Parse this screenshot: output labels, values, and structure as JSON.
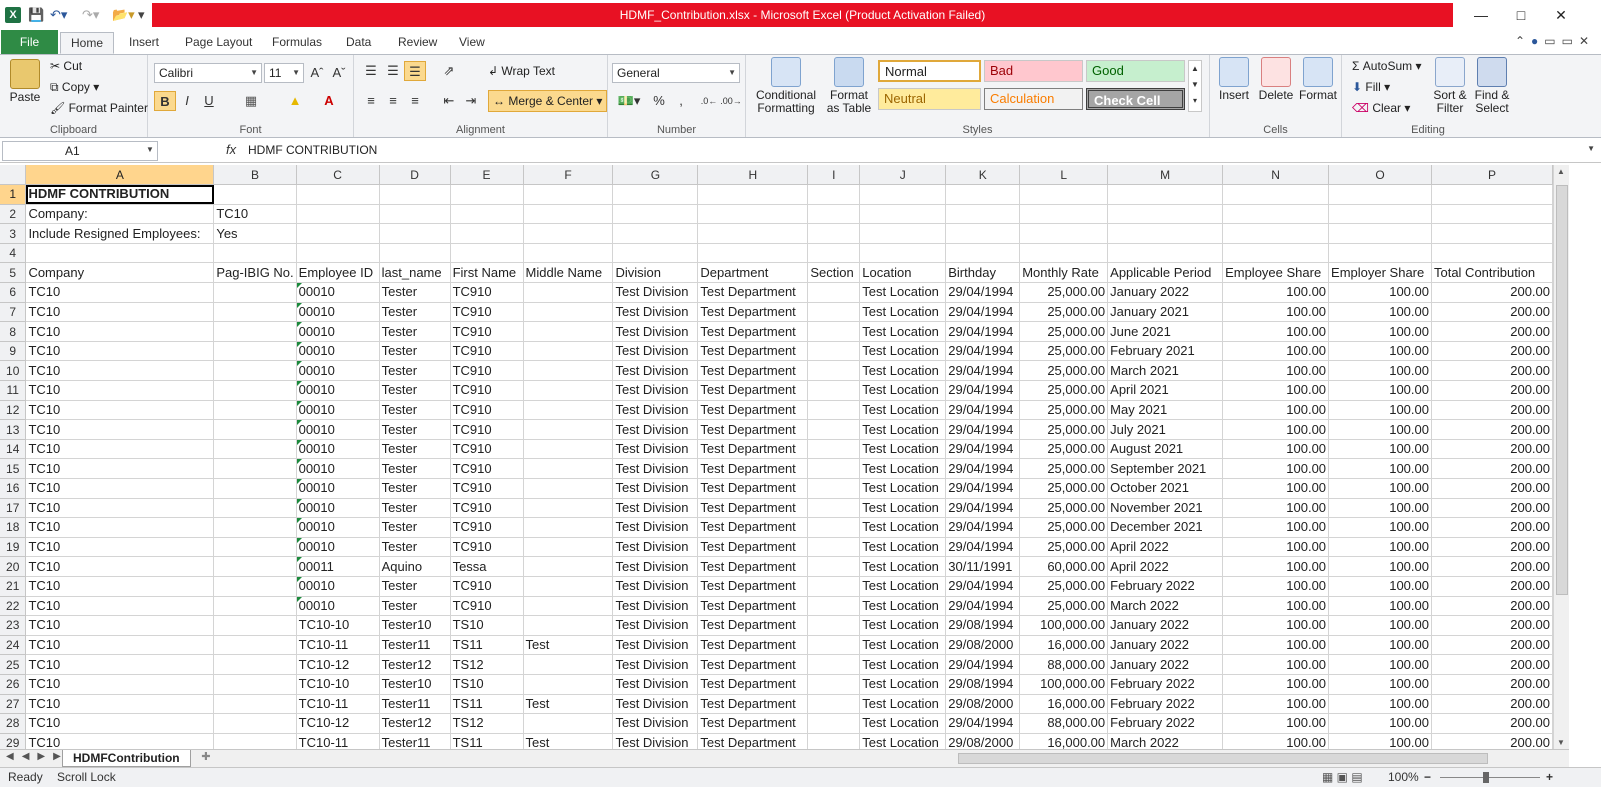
{
  "window": {
    "title": "HDMF_Contribution.xlsx  -  Microsoft Excel (Product Activation Failed)"
  },
  "tabs": [
    "File",
    "Home",
    "Insert",
    "Page Layout",
    "Formulas",
    "Data",
    "Review",
    "View"
  ],
  "ribbon": {
    "clipboard": {
      "paste": "Paste",
      "cut": "Cut",
      "copy": "Copy",
      "format_painter": "Format Painter",
      "group": "Clipboard"
    },
    "font": {
      "name": "Calibri",
      "size": "11",
      "group": "Font"
    },
    "alignment": {
      "wrap": "Wrap Text",
      "merge": "Merge & Center",
      "group": "Alignment"
    },
    "number": {
      "format": "General",
      "group": "Number"
    },
    "styles": {
      "cond_format": "Conditional Formatting",
      "format_table": "Format as Table",
      "normal": "Normal",
      "bad": "Bad",
      "good": "Good",
      "neutral": "Neutral",
      "calculation": "Calculation",
      "check_cell": "Check Cell",
      "group": "Styles"
    },
    "cells": {
      "insert": "Insert",
      "delete": "Delete",
      "format": "Format",
      "group": "Cells"
    },
    "editing": {
      "autosum": "AutoSum",
      "fill": "Fill",
      "clear": "Clear",
      "sort": "Sort & Filter",
      "find": "Find & Select",
      "group": "Editing"
    }
  },
  "formula_bar": {
    "name_box": "A1",
    "fx": "fx",
    "value": "HDMF CONTRIBUTION"
  },
  "columns": [
    "A",
    "B",
    "C",
    "D",
    "E",
    "F",
    "G",
    "H",
    "I",
    "J",
    "K",
    "L",
    "M",
    "N",
    "O",
    "P"
  ],
  "rows": [
    [
      "HDMF CONTRIBUTION",
      "",
      "",
      "",
      "",
      "",
      "",
      "",
      "",
      "",
      "",
      "",
      "",
      "",
      "",
      ""
    ],
    [
      "Company:",
      "TC10",
      "",
      "",
      "",
      "",
      "",
      "",
      "",
      "",
      "",
      "",
      "",
      "",
      "",
      ""
    ],
    [
      "Include Resigned Employees:",
      "Yes",
      "",
      "",
      "",
      "",
      "",
      "",
      "",
      "",
      "",
      "",
      "",
      "",
      "",
      ""
    ],
    [
      "",
      "",
      "",
      "",
      "",
      "",
      "",
      "",
      "",
      "",
      "",
      "",
      "",
      "",
      "",
      ""
    ],
    [
      "Company",
      "Pag-IBIG No.",
      "Employee ID",
      "last_name",
      "First Name",
      "Middle Name",
      "Division",
      "Department",
      "Section",
      "Location",
      "Birthday",
      "Monthly Rate",
      "Applicable Period",
      "Employee Share",
      "Employer Share",
      "Total Contribution"
    ],
    [
      "TC10",
      "",
      "00010",
      "Tester",
      "TC910",
      "",
      "Test Division",
      "Test Department",
      "",
      "Test Location",
      "29/04/1994",
      "25,000.00",
      "January 2022",
      "100.00",
      "100.00",
      "200.00"
    ],
    [
      "TC10",
      "",
      "00010",
      "Tester",
      "TC910",
      "",
      "Test Division",
      "Test Department",
      "",
      "Test Location",
      "29/04/1994",
      "25,000.00",
      "January 2021",
      "100.00",
      "100.00",
      "200.00"
    ],
    [
      "TC10",
      "",
      "00010",
      "Tester",
      "TC910",
      "",
      "Test Division",
      "Test Department",
      "",
      "Test Location",
      "29/04/1994",
      "25,000.00",
      "June 2021",
      "100.00",
      "100.00",
      "200.00"
    ],
    [
      "TC10",
      "",
      "00010",
      "Tester",
      "TC910",
      "",
      "Test Division",
      "Test Department",
      "",
      "Test Location",
      "29/04/1994",
      "25,000.00",
      "February 2021",
      "100.00",
      "100.00",
      "200.00"
    ],
    [
      "TC10",
      "",
      "00010",
      "Tester",
      "TC910",
      "",
      "Test Division",
      "Test Department",
      "",
      "Test Location",
      "29/04/1994",
      "25,000.00",
      "March 2021",
      "100.00",
      "100.00",
      "200.00"
    ],
    [
      "TC10",
      "",
      "00010",
      "Tester",
      "TC910",
      "",
      "Test Division",
      "Test Department",
      "",
      "Test Location",
      "29/04/1994",
      "25,000.00",
      "April 2021",
      "100.00",
      "100.00",
      "200.00"
    ],
    [
      "TC10",
      "",
      "00010",
      "Tester",
      "TC910",
      "",
      "Test Division",
      "Test Department",
      "",
      "Test Location",
      "29/04/1994",
      "25,000.00",
      "May 2021",
      "100.00",
      "100.00",
      "200.00"
    ],
    [
      "TC10",
      "",
      "00010",
      "Tester",
      "TC910",
      "",
      "Test Division",
      "Test Department",
      "",
      "Test Location",
      "29/04/1994",
      "25,000.00",
      "July 2021",
      "100.00",
      "100.00",
      "200.00"
    ],
    [
      "TC10",
      "",
      "00010",
      "Tester",
      "TC910",
      "",
      "Test Division",
      "Test Department",
      "",
      "Test Location",
      "29/04/1994",
      "25,000.00",
      "August 2021",
      "100.00",
      "100.00",
      "200.00"
    ],
    [
      "TC10",
      "",
      "00010",
      "Tester",
      "TC910",
      "",
      "Test Division",
      "Test Department",
      "",
      "Test Location",
      "29/04/1994",
      "25,000.00",
      "September 2021",
      "100.00",
      "100.00",
      "200.00"
    ],
    [
      "TC10",
      "",
      "00010",
      "Tester",
      "TC910",
      "",
      "Test Division",
      "Test Department",
      "",
      "Test Location",
      "29/04/1994",
      "25,000.00",
      "October 2021",
      "100.00",
      "100.00",
      "200.00"
    ],
    [
      "TC10",
      "",
      "00010",
      "Tester",
      "TC910",
      "",
      "Test Division",
      "Test Department",
      "",
      "Test Location",
      "29/04/1994",
      "25,000.00",
      "November 2021",
      "100.00",
      "100.00",
      "200.00"
    ],
    [
      "TC10",
      "",
      "00010",
      "Tester",
      "TC910",
      "",
      "Test Division",
      "Test Department",
      "",
      "Test Location",
      "29/04/1994",
      "25,000.00",
      "December 2021",
      "100.00",
      "100.00",
      "200.00"
    ],
    [
      "TC10",
      "",
      "00010",
      "Tester",
      "TC910",
      "",
      "Test Division",
      "Test Department",
      "",
      "Test Location",
      "29/04/1994",
      "25,000.00",
      "April 2022",
      "100.00",
      "100.00",
      "200.00"
    ],
    [
      "TC10",
      "",
      "00011",
      "Aquino",
      "Tessa",
      "",
      "Test Division",
      "Test Department",
      "",
      "Test Location",
      "30/11/1991",
      "60,000.00",
      "April 2022",
      "100.00",
      "100.00",
      "200.00"
    ],
    [
      "TC10",
      "",
      "00010",
      "Tester",
      "TC910",
      "",
      "Test Division",
      "Test Department",
      "",
      "Test Location",
      "29/04/1994",
      "25,000.00",
      "February 2022",
      "100.00",
      "100.00",
      "200.00"
    ],
    [
      "TC10",
      "",
      "00010",
      "Tester",
      "TC910",
      "",
      "Test Division",
      "Test Department",
      "",
      "Test Location",
      "29/04/1994",
      "25,000.00",
      "March 2022",
      "100.00",
      "100.00",
      "200.00"
    ],
    [
      "TC10",
      "",
      "TC10-10",
      "Tester10",
      "TS10",
      "",
      "Test Division",
      "Test Department",
      "",
      "Test Location",
      "29/08/1994",
      "100,000.00",
      "January 2022",
      "100.00",
      "100.00",
      "200.00"
    ],
    [
      "TC10",
      "",
      "TC10-11",
      "Tester11",
      "TS11",
      "Test",
      "Test Division",
      "Test Department",
      "",
      "Test Location",
      "29/08/2000",
      "16,000.00",
      "January 2022",
      "100.00",
      "100.00",
      "200.00"
    ],
    [
      "TC10",
      "",
      "TC10-12",
      "Tester12",
      "TS12",
      "",
      "Test Division",
      "Test Department",
      "",
      "Test Location",
      "29/04/1994",
      "88,000.00",
      "January 2022",
      "100.00",
      "100.00",
      "200.00"
    ],
    [
      "TC10",
      "",
      "TC10-10",
      "Tester10",
      "TS10",
      "",
      "Test Division",
      "Test Department",
      "",
      "Test Location",
      "29/08/1994",
      "100,000.00",
      "February 2022",
      "100.00",
      "100.00",
      "200.00"
    ],
    [
      "TC10",
      "",
      "TC10-11",
      "Tester11",
      "TS11",
      "Test",
      "Test Division",
      "Test Department",
      "",
      "Test Location",
      "29/08/2000",
      "16,000.00",
      "February 2022",
      "100.00",
      "100.00",
      "200.00"
    ],
    [
      "TC10",
      "",
      "TC10-12",
      "Tester12",
      "TS12",
      "",
      "Test Division",
      "Test Department",
      "",
      "Test Location",
      "29/04/1994",
      "88,000.00",
      "February 2022",
      "100.00",
      "100.00",
      "200.00"
    ],
    [
      "TC10",
      "",
      "TC10-11",
      "Tester11",
      "TS11",
      "Test",
      "Test Division",
      "Test Department",
      "",
      "Test Location",
      "29/08/2000",
      "16,000.00",
      "March 2022",
      "100.00",
      "100.00",
      "200.00"
    ]
  ],
  "sheet_tab": "HDMFContribution",
  "status": {
    "ready": "Ready",
    "scroll_lock": "Scroll Lock",
    "zoom": "100%"
  }
}
